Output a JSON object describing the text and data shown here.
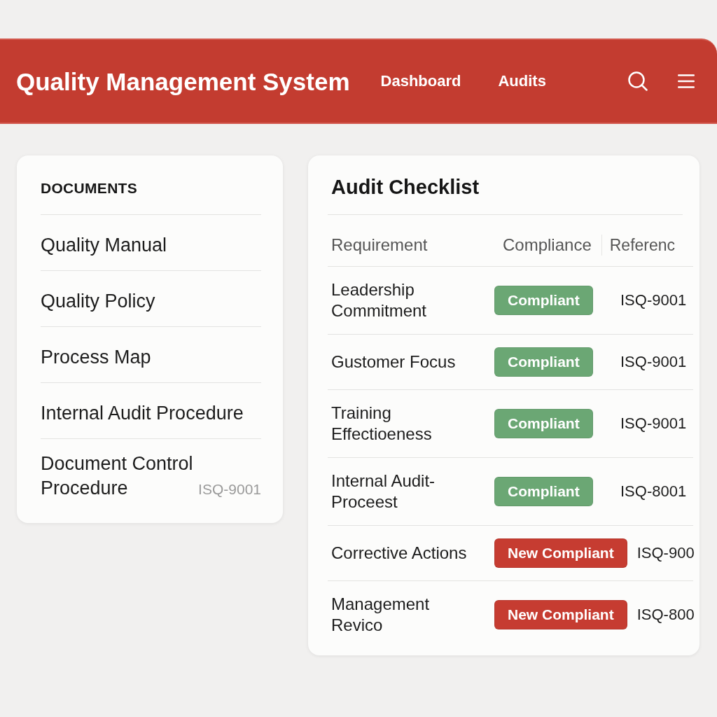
{
  "header": {
    "title": "Quality Management System",
    "nav": [
      {
        "label": "Dashboard"
      },
      {
        "label": "Audits"
      }
    ]
  },
  "documents": {
    "title": "DOCUMENTS",
    "items": [
      {
        "label": "Quality Manual"
      },
      {
        "label": "Quality Policy"
      },
      {
        "label": "Process Map"
      },
      {
        "label": "Internal Audit Procedure"
      },
      {
        "label": "Document Control Procedure",
        "reference": "ISQ-9001"
      }
    ]
  },
  "checklist": {
    "title": "Audit Checklist",
    "columns": [
      "Requirement",
      "Compliance",
      "Referenc"
    ],
    "rows": [
      {
        "requirement": "Leadership Commitment",
        "compliance": {
          "label": "Compliant",
          "color": "#6ba774"
        },
        "reference": "ISQ-9001"
      },
      {
        "requirement": "Gustomer Focus",
        "compliance": {
          "label": "Compliant",
          "color": "#6ba774"
        },
        "reference": "ISQ-9001"
      },
      {
        "requirement": "Training Effectioeness",
        "compliance": {
          "label": "Compliant",
          "color": "#6ba774"
        },
        "reference": "ISQ-9001"
      },
      {
        "requirement": "Internal Audit-Proceest",
        "compliance": {
          "label": "Compliant",
          "color": "#6ba774"
        },
        "reference": "ISQ-8001"
      },
      {
        "requirement": "Corrective Actions",
        "compliance": {
          "label": "New Compliant",
          "color": "#c63c31"
        },
        "reference": "ISQ-900"
      },
      {
        "requirement": "Management Revico",
        "compliance": {
          "label": "New Compliant",
          "color": "#c63c31"
        },
        "reference": "ISQ-800"
      }
    ]
  }
}
